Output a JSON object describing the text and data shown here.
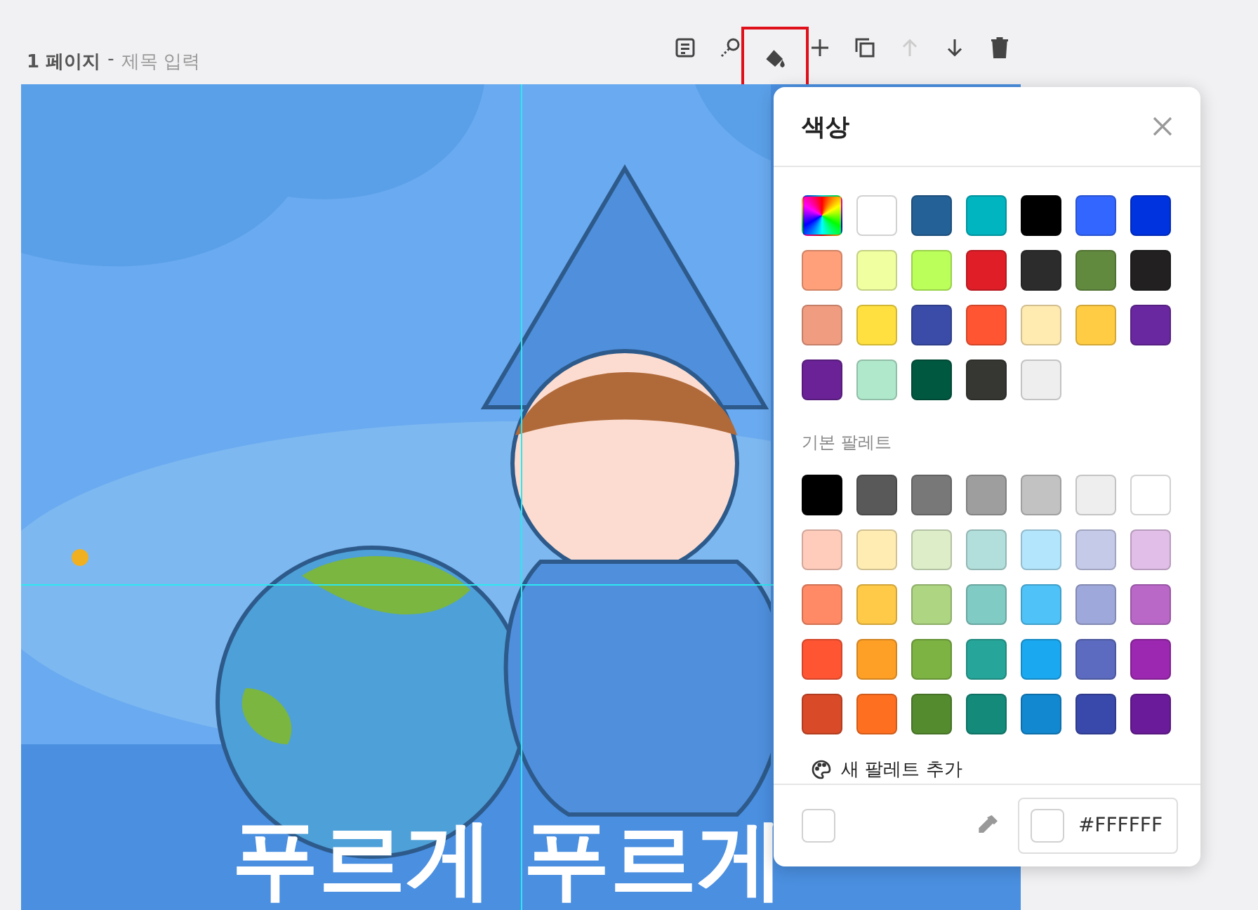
{
  "page": {
    "number": "1 페이지",
    "separator": "-",
    "title_placeholder": "제목 입력"
  },
  "toolbar": [
    {
      "kind": "note",
      "selected": false,
      "disabled": false
    },
    {
      "kind": "magic",
      "selected": false,
      "disabled": false
    },
    {
      "kind": "fill",
      "selected": true,
      "disabled": false
    },
    {
      "kind": "add",
      "selected": false,
      "disabled": false
    },
    {
      "kind": "copy",
      "selected": false,
      "disabled": false
    },
    {
      "kind": "up",
      "selected": false,
      "disabled": true
    },
    {
      "kind": "down",
      "selected": false,
      "disabled": false
    },
    {
      "kind": "delete",
      "selected": false,
      "disabled": false
    }
  ],
  "canvas": {
    "heading": "푸르게 푸르게"
  },
  "color_panel": {
    "title": "색상",
    "recent": [
      {
        "kind": "spectrum"
      },
      {
        "color": "#ffffff"
      },
      {
        "color": "#246196"
      },
      {
        "color": "#00b4c0"
      },
      {
        "color": "#000000"
      },
      {
        "color": "#3366ff"
      },
      {
        "color": "#0033e0"
      },
      {
        "color": "#ffa07a"
      },
      {
        "color": "#f0ffa0"
      },
      {
        "color": "#bbff5a"
      },
      {
        "color": "#e01e28"
      },
      {
        "color": "#2c2c2c"
      },
      {
        "color": "#628a3e"
      },
      {
        "color": "#222020"
      },
      {
        "color": "#f09c80"
      },
      {
        "color": "#ffe040"
      },
      {
        "color": "#3a4ca8"
      },
      {
        "color": "#ff5533"
      },
      {
        "color": "#ffeab0"
      },
      {
        "color": "#ffcc44"
      },
      {
        "color": "#6a28a0"
      },
      {
        "color": "#6a2296"
      },
      {
        "color": "#b0e8cc"
      },
      {
        "color": "#005840"
      },
      {
        "color": "#363632"
      },
      {
        "color": "#eeeeee"
      }
    ],
    "palette_title": "기본 팔레트",
    "palette": [
      {
        "color": "#000000"
      },
      {
        "color": "#595959"
      },
      {
        "color": "#787878"
      },
      {
        "color": "#9e9e9e"
      },
      {
        "color": "#c2c2c2"
      },
      {
        "color": "#eeeeee"
      },
      {
        "color": "#ffffff"
      },
      {
        "color": "#ffccbc"
      },
      {
        "color": "#ffecb3"
      },
      {
        "color": "#dcedc8"
      },
      {
        "color": "#b2dfdb"
      },
      {
        "color": "#b3e5fc"
      },
      {
        "color": "#c5cae9"
      },
      {
        "color": "#e1bee7"
      },
      {
        "color": "#ff8a65"
      },
      {
        "color": "#ffca47"
      },
      {
        "color": "#aed581"
      },
      {
        "color": "#80cbc4"
      },
      {
        "color": "#4fc3f7"
      },
      {
        "color": "#9fa8da"
      },
      {
        "color": "#ba68c8"
      },
      {
        "color": "#ff5533"
      },
      {
        "color": "#ffa026"
      },
      {
        "color": "#7cb342"
      },
      {
        "color": "#26a69a"
      },
      {
        "color": "#1aa8f0"
      },
      {
        "color": "#5c6bc0"
      },
      {
        "color": "#9c27b0"
      },
      {
        "color": "#d84a28"
      },
      {
        "color": "#ff6f20"
      },
      {
        "color": "#558b2f"
      },
      {
        "color": "#138a7a"
      },
      {
        "color": "#1188d0"
      },
      {
        "color": "#3949ab"
      },
      {
        "color": "#6a1b9a"
      }
    ],
    "add_palette": "새 팔레트 추가",
    "current_swatch": {
      "color": "#ffffff"
    },
    "hex_value": "#FFFFFF"
  }
}
